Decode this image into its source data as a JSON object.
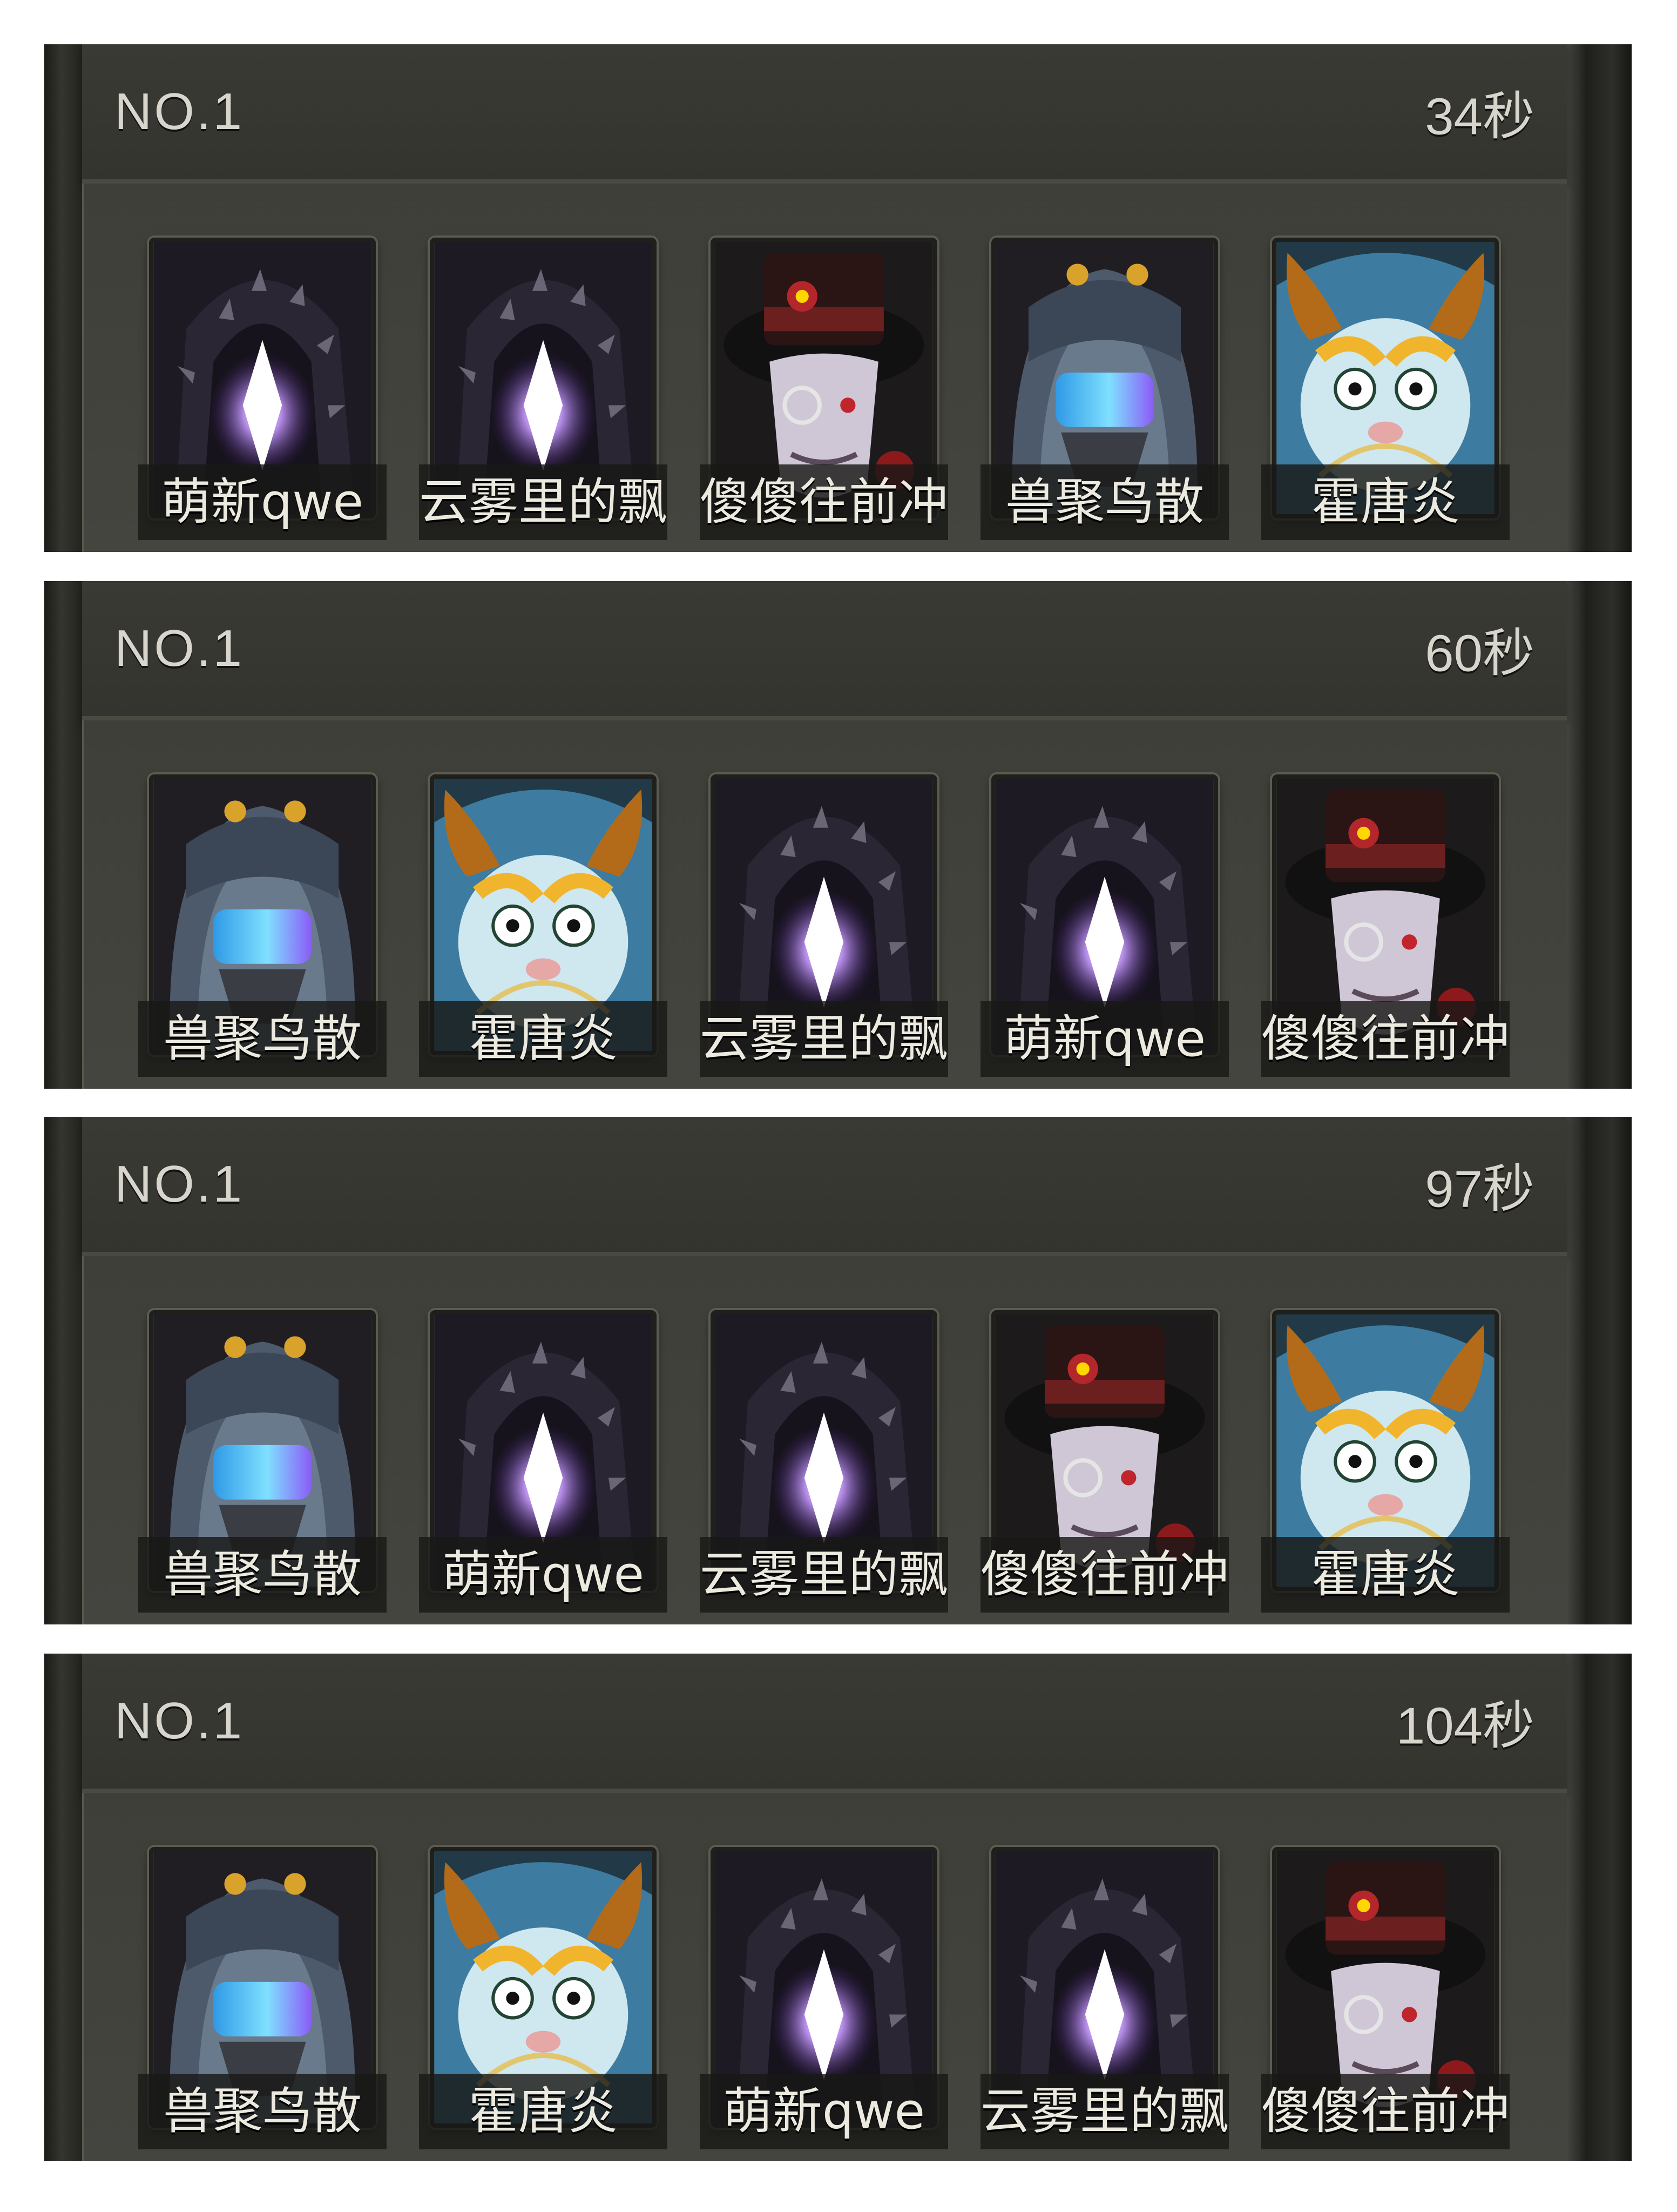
{
  "panels": [
    {
      "rank": "NO.1",
      "time": "34秒",
      "heroes": [
        {
          "name": "萌新qwe",
          "portrait": "hooded-figure-icon"
        },
        {
          "name": "云雾里的飘",
          "portrait": "hooded-figure-icon"
        },
        {
          "name": "傻傻往前冲",
          "portrait": "top-hat-gentleman-icon"
        },
        {
          "name": "兽聚鸟散",
          "portrait": "masked-girl-icon"
        },
        {
          "name": "霍唐炎",
          "portrait": "dragon-hood-brawler-icon"
        }
      ]
    },
    {
      "rank": "NO.1",
      "time": "60秒",
      "heroes": [
        {
          "name": "兽聚鸟散",
          "portrait": "masked-girl-icon"
        },
        {
          "name": "霍唐炎",
          "portrait": "dragon-hood-brawler-icon"
        },
        {
          "name": "云雾里的飘",
          "portrait": "hooded-figure-icon"
        },
        {
          "name": "萌新qwe",
          "portrait": "hooded-figure-icon"
        },
        {
          "name": "傻傻往前冲",
          "portrait": "top-hat-gentleman-icon"
        }
      ]
    },
    {
      "rank": "NO.1",
      "time": "97秒",
      "heroes": [
        {
          "name": "兽聚鸟散",
          "portrait": "masked-girl-icon"
        },
        {
          "name": "萌新qwe",
          "portrait": "hooded-figure-icon"
        },
        {
          "name": "云雾里的飘",
          "portrait": "hooded-figure-icon"
        },
        {
          "name": "傻傻往前冲",
          "portrait": "top-hat-gentleman-icon"
        },
        {
          "name": "霍唐炎",
          "portrait": "dragon-hood-brawler-icon"
        }
      ]
    },
    {
      "rank": "NO.1",
      "time": "104秒",
      "heroes": [
        {
          "name": "兽聚鸟散",
          "portrait": "masked-girl-icon"
        },
        {
          "name": "霍唐炎",
          "portrait": "dragon-hood-brawler-icon"
        },
        {
          "name": "萌新qwe",
          "portrait": "hooded-figure-icon"
        },
        {
          "name": "云雾里的飘",
          "portrait": "hooded-figure-icon"
        },
        {
          "name": "傻傻往前冲",
          "portrait": "top-hat-gentleman-icon"
        }
      ]
    }
  ],
  "colors": {
    "hood_glow": "#9b4dff",
    "mask_visor": "#4fc3ff",
    "brawler_skin": "#bfe3ee",
    "hat_band": "#6b1f1f"
  }
}
